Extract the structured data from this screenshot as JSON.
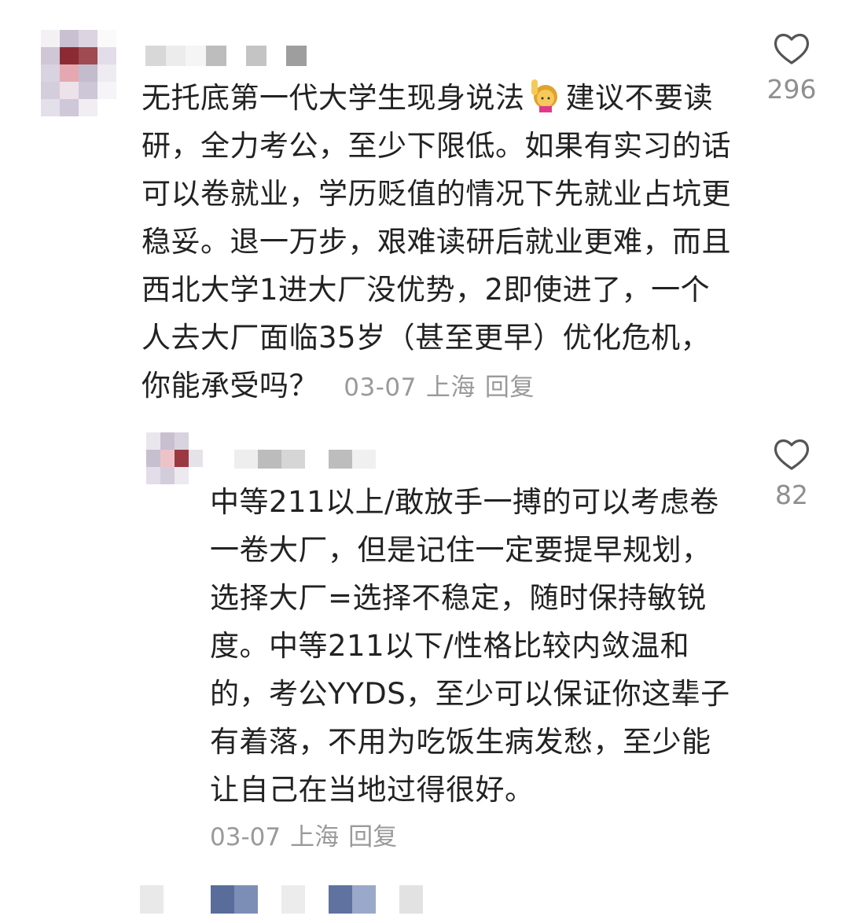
{
  "comments": [
    {
      "username": "",
      "body_before_emoji": "无托底第一代大学生现身说法",
      "emoji": "raising-hand-woman-emoji",
      "body_after_emoji": "建议不要读研，全力考公，至少下限低。如果有实习的话可以卷就业，学历贬值的情况下先就业占坑更稳妥。退一万步，艰难读研后就业更难，而且西北大学1进大厂没优势，2即使进了，一个人去大厂面临35岁（甚至更早）优化危机，你能承受吗？",
      "date": "03-07",
      "location": "上海",
      "reply_label": "回复",
      "likes": "296"
    },
    {
      "username": "",
      "body": "中等211以上/敢放手一搏的可以考虑卷一卷大厂，但是记住一定要提早规划，选择大厂=选择不稳定，随时保持敏锐度。中等211以下/性格比较内敛温和的，考公YYDS，至少可以保证你这辈子有着落，不用为吃饭生病发愁，至少能让自己在当地过得很好。",
      "date": "03-07",
      "location": "上海",
      "reply_label": "回复",
      "likes": "82"
    }
  ],
  "icons": {
    "like": "heart-outline-icon"
  },
  "colors": {
    "text": "#222222",
    "meta": "#9a9a9a",
    "like_outline": "#555555"
  }
}
